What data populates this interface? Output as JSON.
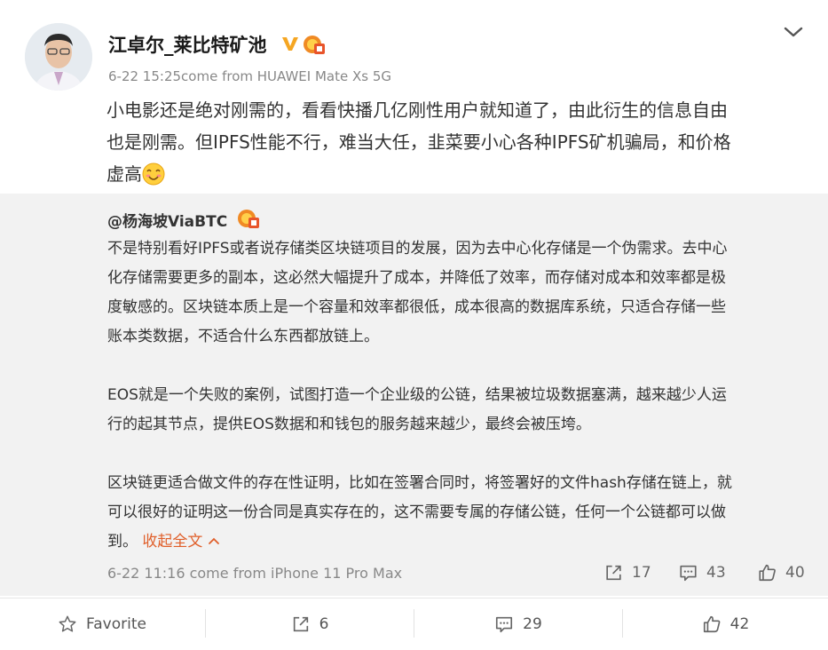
{
  "post": {
    "author": "江卓尔_莱比特矿池",
    "meta": "6-22 15:25come from HUAWEI Mate Xs 5G",
    "text": "小电影还是绝对刚需的，看看快播几亿刚性用户就知道了，由此衍生的信息自由\n也是刚需。但IPFS性能不行，难当大任，韭菜要小心各种IPFS矿机骗局，和价格\n虚高"
  },
  "repost": {
    "author": "@杨海坡ViaBTC",
    "body": "不是特别看好IPFS或者说存储类区块链项目的发展，因为去中心化存储是一个伪需求。去中心\n化存储需要更多的副本，这必然大幅提升了成本，并降低了效率，而存储对成本和效率都是极\n度敏感的。区块链本质上是一个容量和效率都很低，成本很高的数据库系统，只适合存储一些\n账本类数据，不适合什么东西都放链上。\n\nEOS就是一个失败的案例，试图打造一个企业级的公链，结果被垃圾数据塞满，越来越少人运\n行的起其节点，提供EOS数据和和钱包的服务越来越少，最终会被压垮。\n\n区块链更适合做文件的存在性证明，比如在签署合同时，将签署好的文件hash存储在链上，就\n可以很好的证明这一份合同是真实存在的，这不需要专属的存储公链，任何一个公链都可以做\n到。 ",
    "collapse_label": "收起全文",
    "meta": "6-22 11:16 come from iPhone 11 Pro Max",
    "shares": "17",
    "comments": "43",
    "likes": "40"
  },
  "actions": {
    "favorite": "Favorite",
    "shares": "6",
    "comments": "29",
    "likes": "42"
  },
  "colors": {
    "accent": "#e05f2a",
    "verified": "#f5a623",
    "repost_bg": "#f2f2f2"
  },
  "icons": [
    "chevron-down-icon",
    "verified-badge-icon",
    "medal-icon",
    "smile-emoji-icon",
    "share-icon",
    "comment-icon",
    "like-icon",
    "star-icon",
    "chevron-up-icon"
  ]
}
